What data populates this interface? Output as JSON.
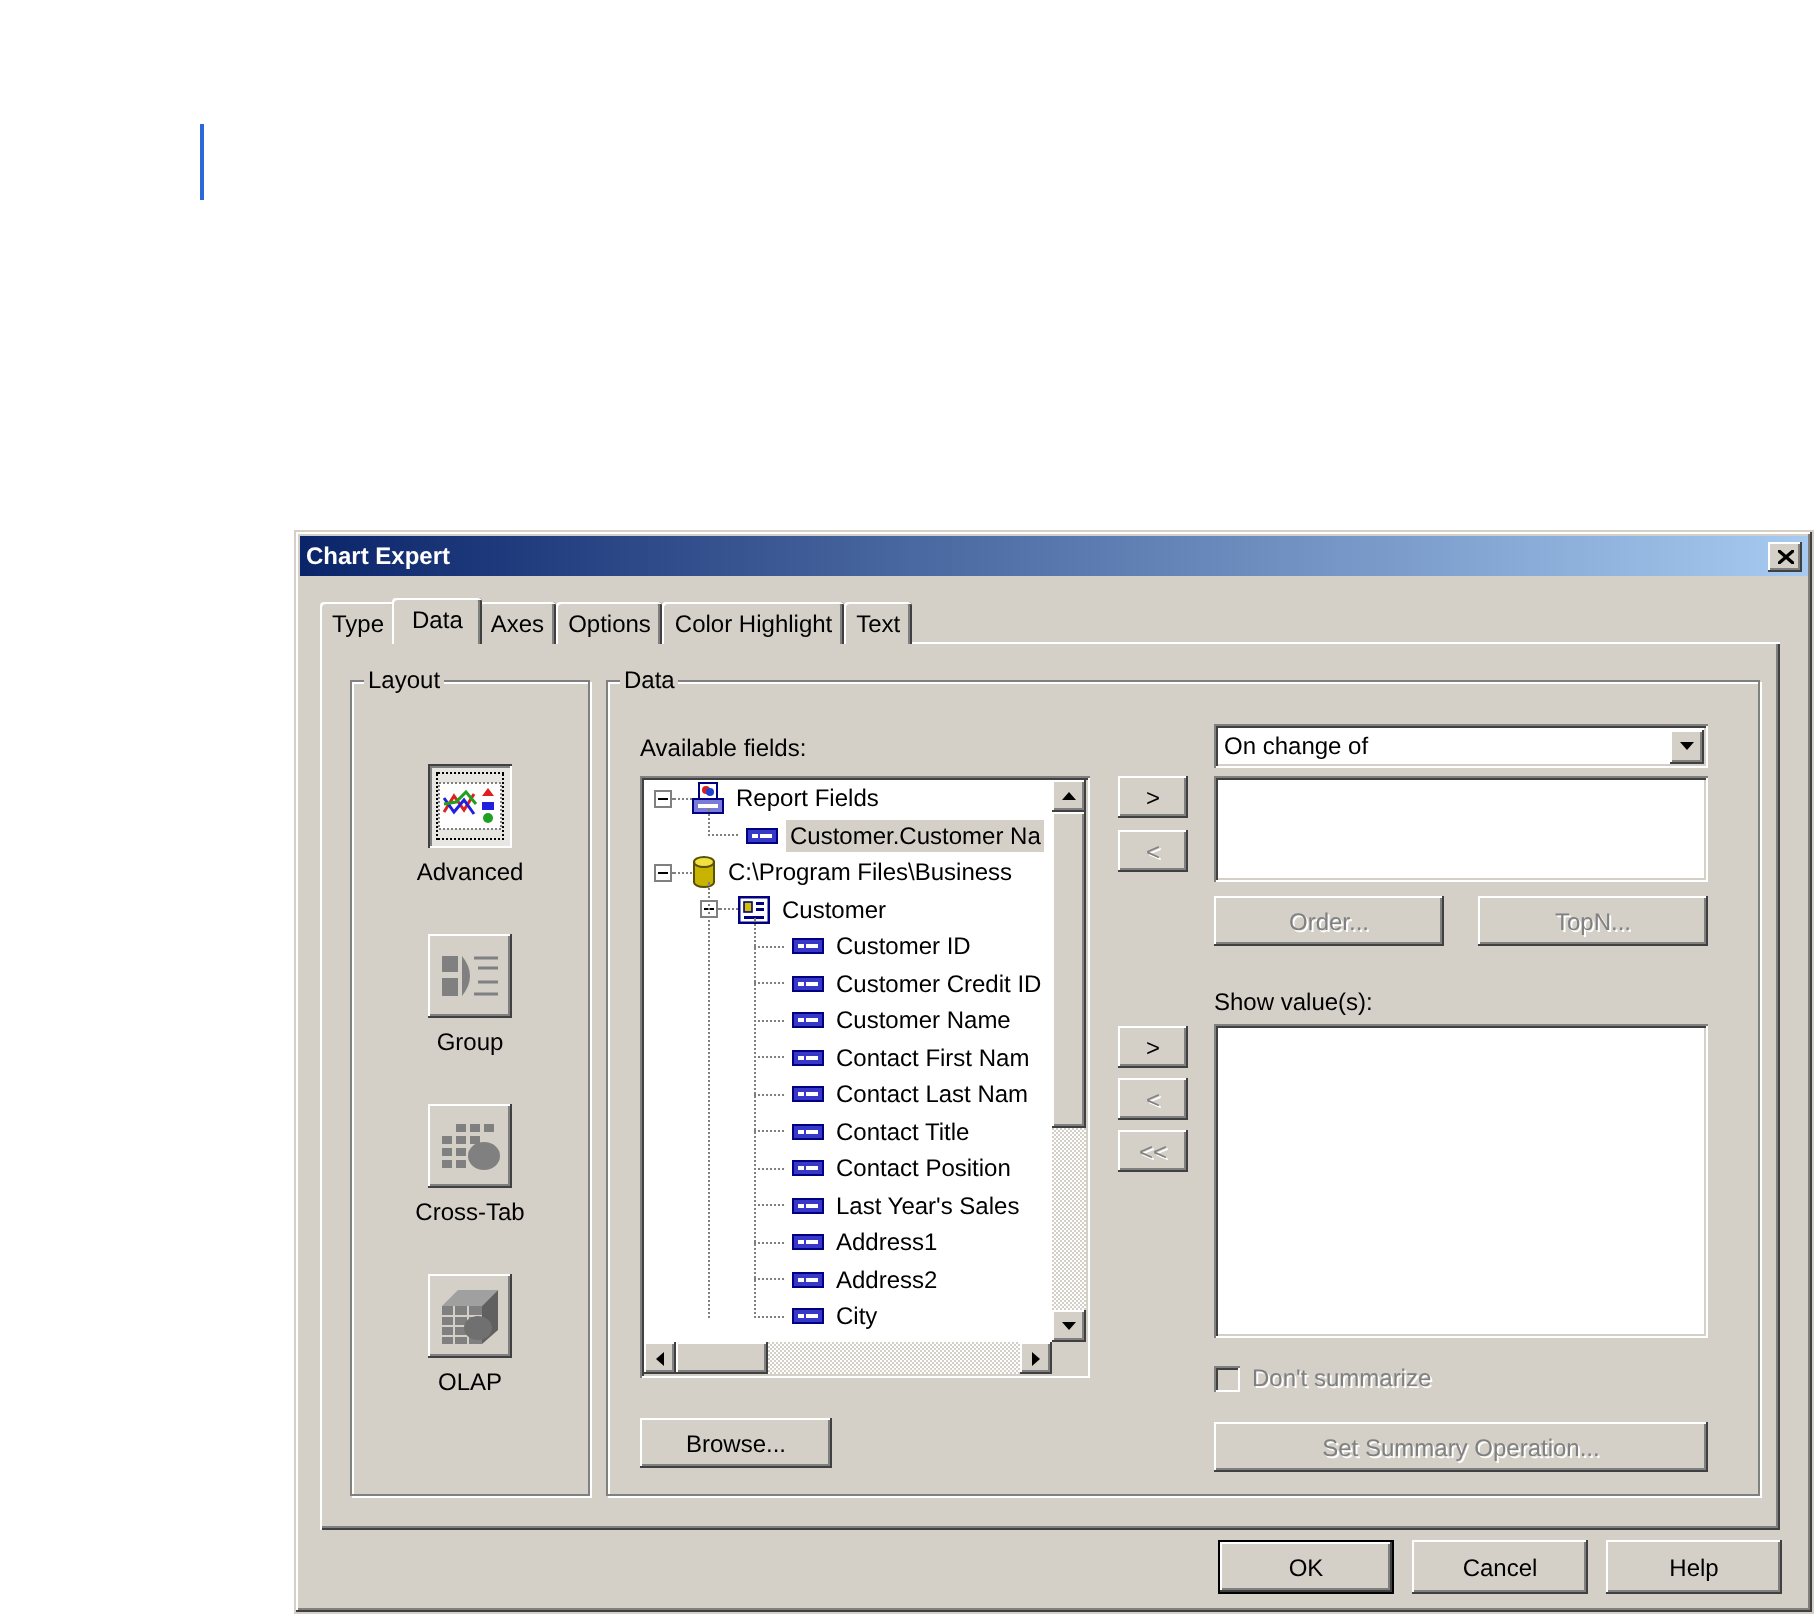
{
  "window": {
    "title": "Chart Expert"
  },
  "tabs": [
    {
      "label": "Type",
      "selected": false
    },
    {
      "label": "Data",
      "selected": true
    },
    {
      "label": "Axes",
      "selected": false
    },
    {
      "label": "Options",
      "selected": false
    },
    {
      "label": "Color Highlight",
      "selected": false
    },
    {
      "label": "Text",
      "selected": false
    }
  ],
  "layout": {
    "label": "Layout",
    "options": [
      {
        "label": "Advanced",
        "kind": "advanced",
        "selected": true
      },
      {
        "label": "Group",
        "kind": "group",
        "selected": false
      },
      {
        "label": "Cross-Tab",
        "kind": "crosstab",
        "selected": false
      },
      {
        "label": "OLAP",
        "kind": "olap",
        "selected": false
      }
    ]
  },
  "data": {
    "label": "Data",
    "available_label": "Available fields:",
    "tree": [
      {
        "label": "Report Fields",
        "kind": "report",
        "expanded": true,
        "selected": false,
        "children": [
          {
            "label": "Customer.Customer Na",
            "kind": "field",
            "selected": true
          }
        ]
      },
      {
        "label": "C:\\Program Files\\Business",
        "kind": "database",
        "expanded": true,
        "selected": false,
        "children": [
          {
            "label": "Customer",
            "kind": "table",
            "expanded": true,
            "selected": false,
            "children": [
              {
                "label": "Customer ID",
                "kind": "field",
                "selected": false
              },
              {
                "label": "Customer Credit ID",
                "kind": "field",
                "selected": false
              },
              {
                "label": "Customer Name",
                "kind": "field",
                "selected": false
              },
              {
                "label": "Contact First Nam",
                "kind": "field",
                "selected": false
              },
              {
                "label": "Contact Last Nam",
                "kind": "field",
                "selected": false
              },
              {
                "label": "Contact Title",
                "kind": "field",
                "selected": false
              },
              {
                "label": "Contact Position",
                "kind": "field",
                "selected": false
              },
              {
                "label": "Last Year's Sales",
                "kind": "field",
                "selected": false
              },
              {
                "label": "Address1",
                "kind": "field",
                "selected": false
              },
              {
                "label": "Address2",
                "kind": "field",
                "selected": false
              },
              {
                "label": "City",
                "kind": "field",
                "selected": false
              }
            ]
          }
        ]
      }
    ],
    "browse": "Browse...",
    "group_by": {
      "value": "On change of"
    },
    "group_buttons": [
      {
        "label": ">",
        "disabled": false
      },
      {
        "label": "<",
        "disabled": true
      }
    ],
    "order": {
      "label": "Order...",
      "disabled": true
    },
    "topn": {
      "label": "TopN...",
      "disabled": true
    },
    "show_label": "Show value(s):",
    "value_buttons": [
      {
        "label": ">",
        "disabled": false
      },
      {
        "label": "<",
        "disabled": true
      },
      {
        "label": "<<",
        "disabled": true
      }
    ],
    "dont_summarize": {
      "label": "Don't summarize",
      "checked": false,
      "disabled": true
    },
    "summary_button": {
      "label": "Set Summary Operation...",
      "disabled": true
    }
  },
  "buttons": [
    {
      "label": "OK",
      "default": true
    },
    {
      "label": "Cancel",
      "default": false
    },
    {
      "label": "Help",
      "default": false
    }
  ]
}
